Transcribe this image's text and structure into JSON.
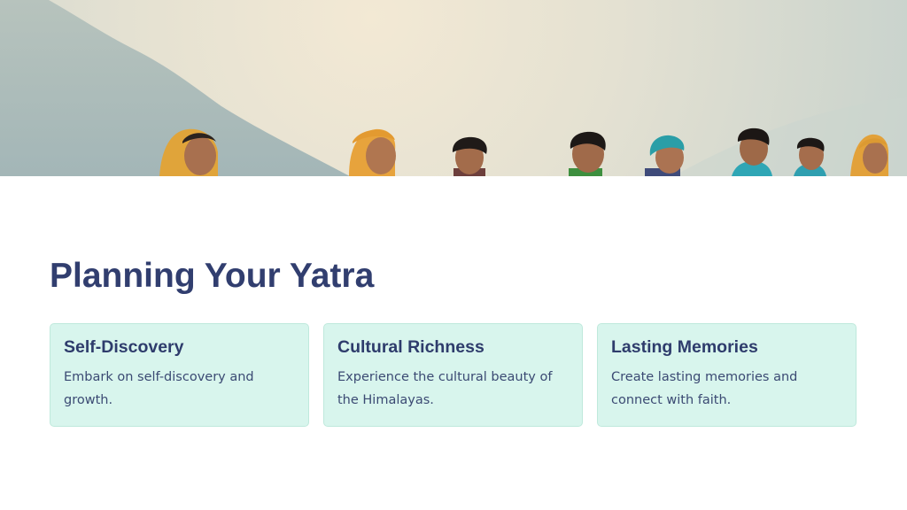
{
  "slide": {
    "title": "Planning Your Yatra"
  },
  "cards": [
    {
      "title": "Self-Discovery",
      "text": "Embark on self-discovery and growth."
    },
    {
      "title": "Cultural Richness",
      "text": "Experience the cultural beauty of the Himalayas."
    },
    {
      "title": "Lasting Memories",
      "text": "Create lasting memories and connect with faith."
    }
  ],
  "colors": {
    "title": "#313e6f",
    "card_background": "#d8f5ed",
    "card_border": "#bfe9dc",
    "sky_warm": "#f1e6d0",
    "mountain": "#a9bcbc"
  }
}
